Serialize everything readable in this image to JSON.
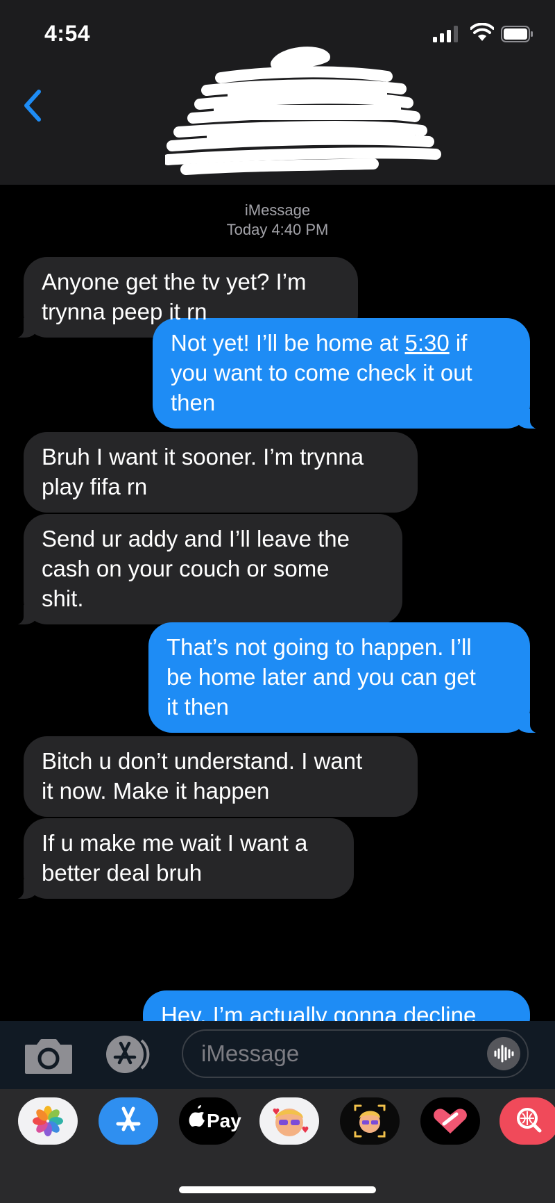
{
  "status_bar": {
    "time": "4:54"
  },
  "conversation": {
    "service": "iMessage",
    "timestamp": "Today 4:40 PM"
  },
  "messages": [
    {
      "dir": "in",
      "lines": [
        "Anyone get the tv yet? I’m",
        "trynna peep it rn"
      ]
    },
    {
      "dir": "out",
      "lines": [
        "Not yet! I’ll be home at 5:30 if",
        "you want to come check it out",
        "then"
      ],
      "link": "5:30"
    },
    {
      "dir": "in",
      "lines": [
        "Bruh I want it sooner. I’m trynna",
        "play fifa rn"
      ]
    },
    {
      "dir": "in",
      "lines": [
        "Send ur addy and I’ll leave the",
        "cash on your couch or some",
        "shit."
      ]
    },
    {
      "dir": "out",
      "lines": [
        "That’s not going to happen. I’ll",
        "be home later and you can get",
        "it then"
      ]
    },
    {
      "dir": "in",
      "lines": [
        "Bitch u don’t understand. I want",
        "it now. Make it happen"
      ]
    },
    {
      "dir": "in",
      "lines": [
        "If u make me wait I want a",
        "better deal bruh"
      ]
    },
    {
      "dir": "out",
      "lines": [
        "Hey, I’m actually gonna decline"
      ]
    }
  ],
  "input": {
    "placeholder": "iMessage"
  },
  "app_drawer": {
    "items": [
      {
        "icon": "photos-icon"
      },
      {
        "icon": "app-store-icon"
      },
      {
        "icon": "apple-pay-icon",
        "label": "Pay"
      },
      {
        "icon": "memoji-stickers-icon"
      },
      {
        "icon": "animoji-icon"
      },
      {
        "icon": "digital-touch-icon"
      },
      {
        "icon": "image-search-icon"
      }
    ]
  },
  "colors": {
    "incoming": "#262628",
    "outgoing": "#1e8cf5",
    "accent": "#1e8cf5",
    "background": "#000000"
  }
}
